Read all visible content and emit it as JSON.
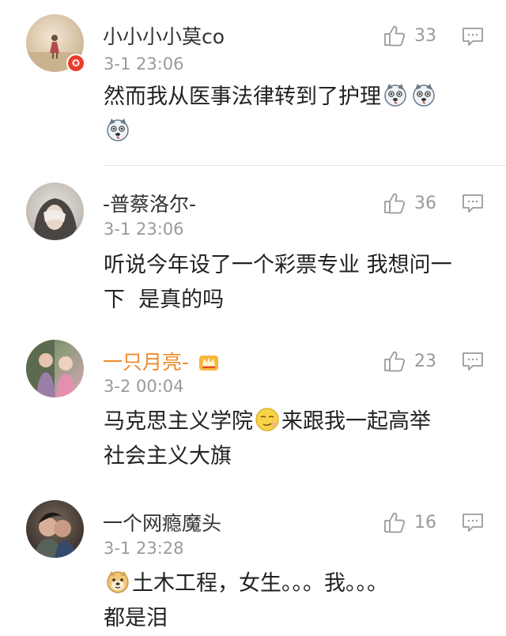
{
  "comments": [
    {
      "username": "小小小小莫co",
      "time": "3-1 23:06",
      "likes": "33",
      "text_lines": [
        "然而我从医事法律转到了护理"
      ]
    },
    {
      "username": "-普蔡洛尔-",
      "time": "3-1 23:06",
      "likes": "36",
      "text_lines": [
        "听说今年设了一个彩票专业 我想问一",
        "下  是真的吗"
      ]
    },
    {
      "username": "一只月亮-",
      "time": "3-2 00:04",
      "likes": "23",
      "text_lines": [
        "马克思主义学院",
        "来跟我一起高举",
        "社会主义大旗"
      ]
    },
    {
      "username": "一个网瘾魔头",
      "time": "3-1 23:28",
      "likes": "16",
      "text_lines": [
        "土木工程，女生。。。我。。。",
        "都是泪"
      ]
    }
  ],
  "colors": {
    "vip_name": "#f08a2c",
    "timestamp": "#9a9a9a",
    "badge": "#ea3d2b"
  },
  "icons": [
    "thumbs-up-icon",
    "reply-icon",
    "crown-icon",
    "husky-emoji",
    "smirk-emoji",
    "doge-emoji"
  ]
}
